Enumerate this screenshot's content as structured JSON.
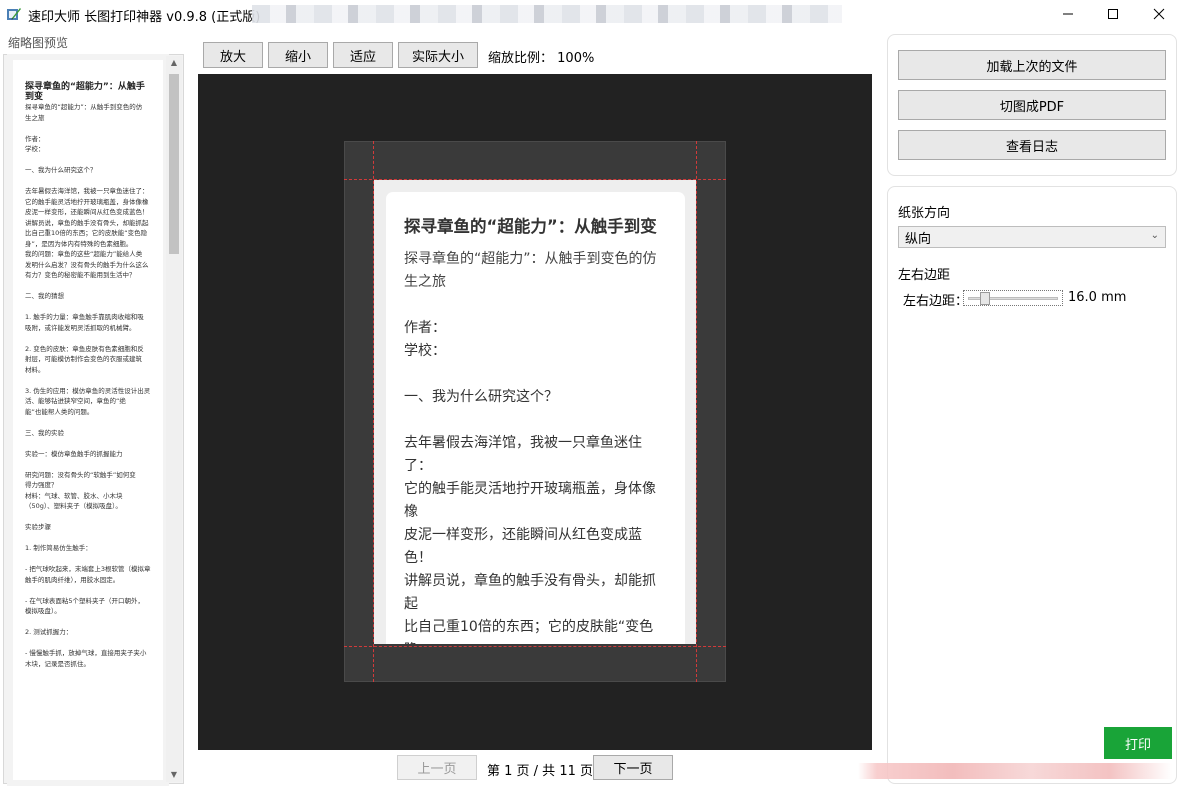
{
  "window": {
    "title": "速印大师 长图打印神器 v0.9.8 (正式版)",
    "controls": [
      "minimize",
      "maximize",
      "close"
    ]
  },
  "thumbnail": {
    "label": "缩略图预览",
    "title": "探寻章鱼的“超能力”：从触手到变",
    "lines": [
      "探寻章鱼的“超能力”：从触手到变色的仿",
      "生之旅",
      "",
      "作者：",
      "学校：",
      "",
      "一、我为什么研究这个？",
      "",
      "去年暑假去海洋馆，我被一只章鱼迷住了：",
      "它的触手能灵活地拧开玻璃瓶盖，身体像橡",
      "皮泥一样变形，还能瞬间从红色变成蓝色！",
      "讲解员说，章鱼的触手没有骨头，却能抓起",
      "比自己重10倍的东西；它的皮肤能“变色隐",
      "身”，是因为体内有特殊的色素细胞。",
      "我的问题：章鱼的这些“超能力”能给人类",
      "发明什么启发？没有骨头的触手为什么这么",
      "有力？变色的秘密能不能用到生活中？",
      "",
      "二、我的猜想",
      "",
      "1. 触手的力量：章鱼触手靠肌肉收缩和吸",
      "吸附，或许能发明灵活抓取的机械臂。",
      "",
      "2. 变色的皮肤：章鱼皮肤有色素细胞和反",
      "射层，可能模仿制作会变色的衣服或建筑",
      "材料。",
      "",
      "3. 伪生的应用：模仿章鱼的灵活性设计出灵",
      "活、能够钻进狭窄空间，章鱼的“绝",
      "能”也能帮人类的问题。",
      "",
      "三、我的实验",
      "",
      "实验一：模仿章鱼触手的抓握能力",
      "",
      "研究问题：没有骨头的“软触手”如何变",
      "得力强度？",
      "材料：气球、软管、胶水、小木块",
      "（50g）、塑料夹子（模拟吸盘）。",
      "",
      "实验步骤",
      "",
      "1. 制作简易仿生触手：",
      "",
      "- 把气球吹起来，末端套上3根软管（模拟章",
      "触手的肌肉纤维），用胶水固定。",
      "",
      "- 在气球表面粘5个塑料夹子（开口朝外，",
      "模拟吸盘）。",
      "",
      "2. 测试抓握力：",
      "",
      "- 慢慢触手抓，放掉气球，直接用夹子夹小",
      "木块，记录是否抓住。"
    ]
  },
  "toolbar": {
    "zoom_in": "放大",
    "zoom_out": "缩小",
    "fit": "适应",
    "actual_size": "实际大小",
    "zoom_label": "缩放比例：",
    "zoom_value": "100%"
  },
  "page": {
    "title": "探寻章鱼的“超能力”：从触手到变",
    "subtitle": "探寻章鱼的“超能力”：从触手到变色的仿生之旅",
    "lines": [
      "",
      "作者：",
      "学校：",
      "",
      "一、我为什么研究这个？",
      "",
      "去年暑假去海洋馆，我被一只章鱼迷住了：",
      "它的触手能灵活地拧开玻璃瓶盖，身体像橡",
      "皮泥一样变形，还能瞬间从红色变成蓝色！",
      "讲解员说，章鱼的触手没有骨头，却能抓起",
      "比自己重10倍的东西；它的皮肤能“变色隐",
      "身”，是因为体内有特殊的色素细胞。",
      "我的问题：章鱼的这些“超能力”能给人类",
      "发明什么启发？没有骨头的触手为什么这么",
      "有力？变色的秘密能不能用到生活中？"
    ]
  },
  "pagination": {
    "prev": "上一页",
    "label": "第 1 页 / 共 11 页",
    "next": "下一页"
  },
  "right_panel": {
    "load_last": "加载上次的文件",
    "to_pdf": "切图成PDF",
    "view_log": "查看日志",
    "orientation_label": "纸张方向",
    "orientation_value": "纵向",
    "margin_group_label": "左右边距",
    "margin_label": "左右边距：",
    "margin_value": "16.0 mm",
    "margin_fraction": 0.15,
    "green_button": "打印"
  },
  "colors": {
    "viewer_bg": "#222222",
    "margin_guides": "#d23a3a",
    "green_button": "#19a438"
  }
}
